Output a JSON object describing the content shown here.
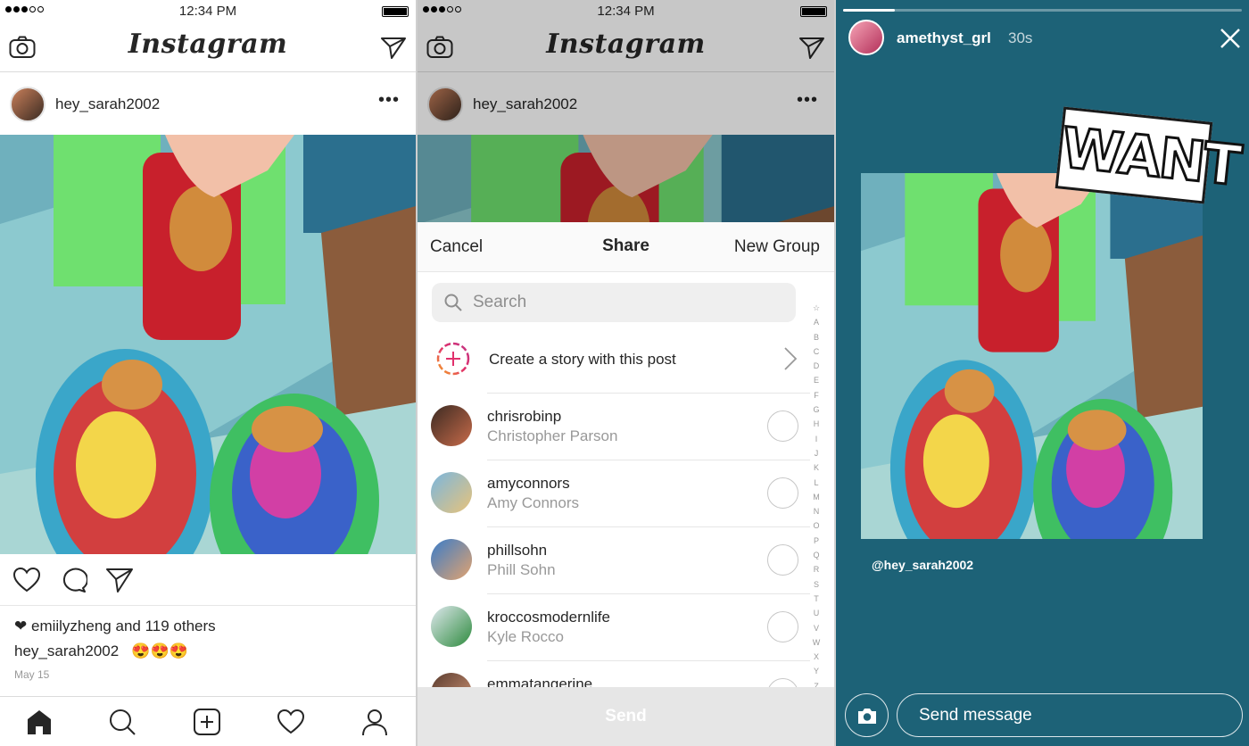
{
  "status": {
    "time": "12:34 PM"
  },
  "app": {
    "logo": "Instagram"
  },
  "feed": {
    "post_user": "hey_sarah2002",
    "more_icon": "more-dots-icon",
    "liked_by": "emiilyzheng",
    "likes_suffix": "and 119 others",
    "caption_user": "hey_sarah2002",
    "caption_text": "😍😍😍",
    "date": "May 15"
  },
  "share": {
    "cancel": "Cancel",
    "title": "Share",
    "new_group": "New Group",
    "search_placeholder": "Search",
    "story_label": "Create a story with this post",
    "contacts": [
      {
        "username": "chrisrobinp",
        "name": "Christopher Parson"
      },
      {
        "username": "amyconnors",
        "name": "Amy Connors"
      },
      {
        "username": "phillsohn",
        "name": "Phill Sohn"
      },
      {
        "username": "kroccosmodernlife",
        "name": "Kyle Rocco"
      },
      {
        "username": "emmatangerine",
        "name": ""
      }
    ],
    "alpha_index": [
      "☆",
      "A",
      "B",
      "C",
      "D",
      "E",
      "F",
      "G",
      "H",
      "I",
      "J",
      "K",
      "L",
      "M",
      "N",
      "O",
      "P",
      "Q",
      "R",
      "S",
      "T",
      "U",
      "V",
      "W",
      "X",
      "Y",
      "Z"
    ],
    "send": "Send"
  },
  "story": {
    "username": "amethyst_grl",
    "time": "30s",
    "sticker": "WANT",
    "mention": "@hey_sarah2002",
    "message_placeholder": "Send message",
    "progress": 0.13
  },
  "colors": {
    "story_bg": "#1d6277",
    "text": "#262626",
    "secondary": "#999999"
  }
}
